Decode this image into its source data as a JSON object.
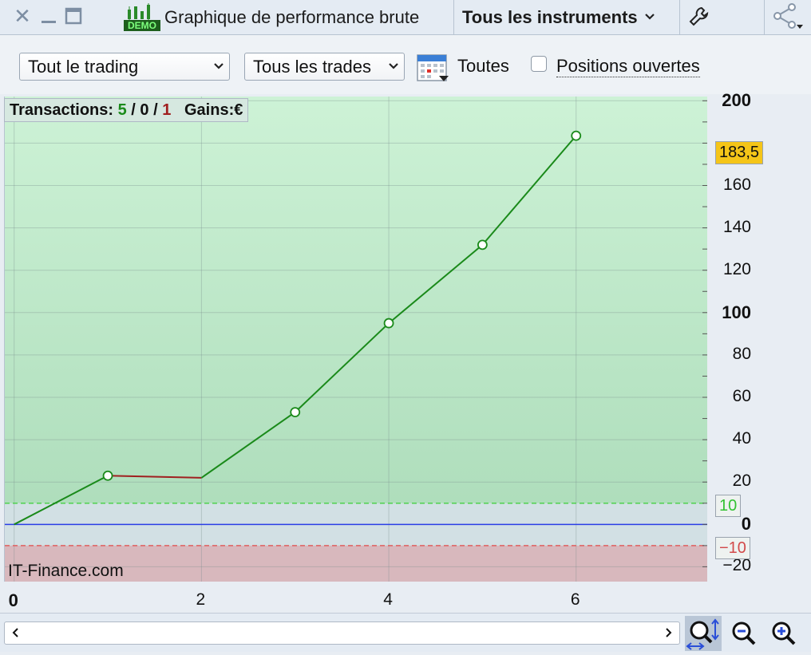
{
  "window": {
    "title": "Graphique de performance brute",
    "demo_badge": "DEMO",
    "instrument": "Tous les instruments",
    "close_icon": "close-icon",
    "minimize_icon": "minimize-icon",
    "maximize_icon": "maximize-icon",
    "settings_icon": "wrench-icon",
    "share_icon": "share-icon"
  },
  "toolbar": {
    "trading_select": "Tout le trading",
    "trades_select": "Tous les trades",
    "period_label": "Toutes",
    "open_positions_label": "Positions ouvertes",
    "open_positions_checked": false
  },
  "legend": {
    "label": "Transactions:",
    "wins": "5",
    "separator1": " / ",
    "neutral": "0",
    "separator2": " / ",
    "losses": "1",
    "gains_label": "Gains:",
    "currency": "€"
  },
  "watermark": "IT-Finance.com",
  "colors": {
    "profit_line": "#1a8a1a",
    "loss_line": "#a02020",
    "zero_line": "#2a3ee6",
    "upper_threshold": "#4fd24f",
    "lower_threshold": "#e06060",
    "last_value_badge": "#f5c518"
  },
  "chart_data": {
    "type": "line",
    "x": [
      0,
      1,
      2,
      3,
      4,
      5,
      6
    ],
    "y": [
      0,
      23,
      22,
      53,
      95,
      132,
      183.5
    ],
    "markers": [
      false,
      true,
      false,
      true,
      true,
      true,
      true
    ],
    "segment_colors": [
      "profit",
      "loss",
      "profit",
      "profit",
      "profit",
      "profit"
    ],
    "xlim": [
      -0.1,
      7.4
    ],
    "ylim": [
      -27,
      202
    ],
    "x_ticks": [
      "0",
      "2",
      "4",
      "6"
    ],
    "x_tick_values": [
      0,
      2,
      4,
      6
    ],
    "y_ticks": [
      "200",
      "160",
      "140",
      "120",
      "100",
      "80",
      "60",
      "40",
      "20",
      "0",
      "−20"
    ],
    "y_tick_values": [
      200,
      160,
      140,
      120,
      100,
      80,
      60,
      40,
      20,
      0,
      -20
    ],
    "last_value": "183,5",
    "upper_threshold": "10",
    "lower_threshold": "−10",
    "grid": true
  },
  "bottom": {
    "scroll_left_icon": "scroll-left-icon",
    "scroll_right_icon": "scroll-right-icon",
    "zoom_fit_icon": "zoom-fit-icon",
    "zoom_out_icon": "zoom-out-icon",
    "zoom_in_icon": "zoom-in-icon"
  }
}
